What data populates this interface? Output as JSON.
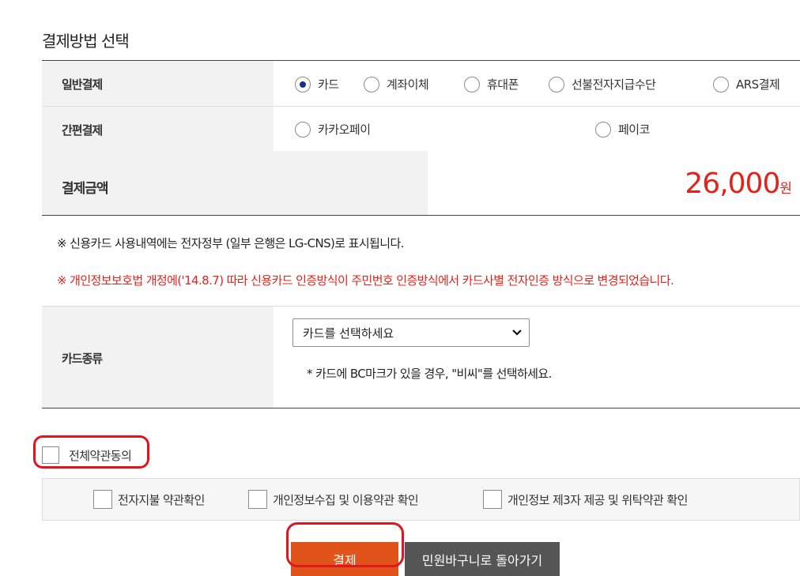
{
  "page_title": "결제방법 선택",
  "general": {
    "label": "일반결제",
    "options": [
      {
        "label": "카드",
        "selected": true
      },
      {
        "label": "계좌이체",
        "selected": false
      },
      {
        "label": "휴대폰",
        "selected": false
      },
      {
        "label": "선불전자지급수단",
        "selected": false
      },
      {
        "label": "ARS결제",
        "selected": false
      }
    ]
  },
  "simple": {
    "label": "간편결제",
    "options": [
      {
        "label": "카카오페이",
        "selected": false
      },
      {
        "label": "페이코",
        "selected": false
      }
    ]
  },
  "amount": {
    "label": "결제금액",
    "value": "26,000",
    "unit": "원"
  },
  "notes": {
    "statement": "※ 신용카드 사용내역에는 전자정부 (일부 은행은 LG-CNS)로 표시됩니다.",
    "warning": "※ 개인정보보호법 개정에('14.8.7) 따라 신용카드 인증방식이 주민번호 인증방식에서 카드사별 전자인증 방식으로 변경되었습니다."
  },
  "card_type": {
    "label": "카드종류",
    "select_value": "카드를 선택하세요",
    "hint": "* 카드에 BC마크가 있을 경우, \"비씨\"를 선택하세요."
  },
  "agreements": {
    "all_label": "전체약관동의",
    "items": [
      {
        "label": "전자지불 약관확인"
      },
      {
        "label": "개인정보수집 및 이용약관 확인"
      },
      {
        "label": "개인정보 제3자 제공 및 위탁약관 확인"
      }
    ]
  },
  "buttons": {
    "pay": "결제",
    "back": "민원바구니로 돌아가기"
  },
  "colors": {
    "accent": "#e0541c",
    "amount": "#e2231a",
    "warning": "#e2231a",
    "annotation": "#e0151f",
    "back_button": "#555555"
  }
}
